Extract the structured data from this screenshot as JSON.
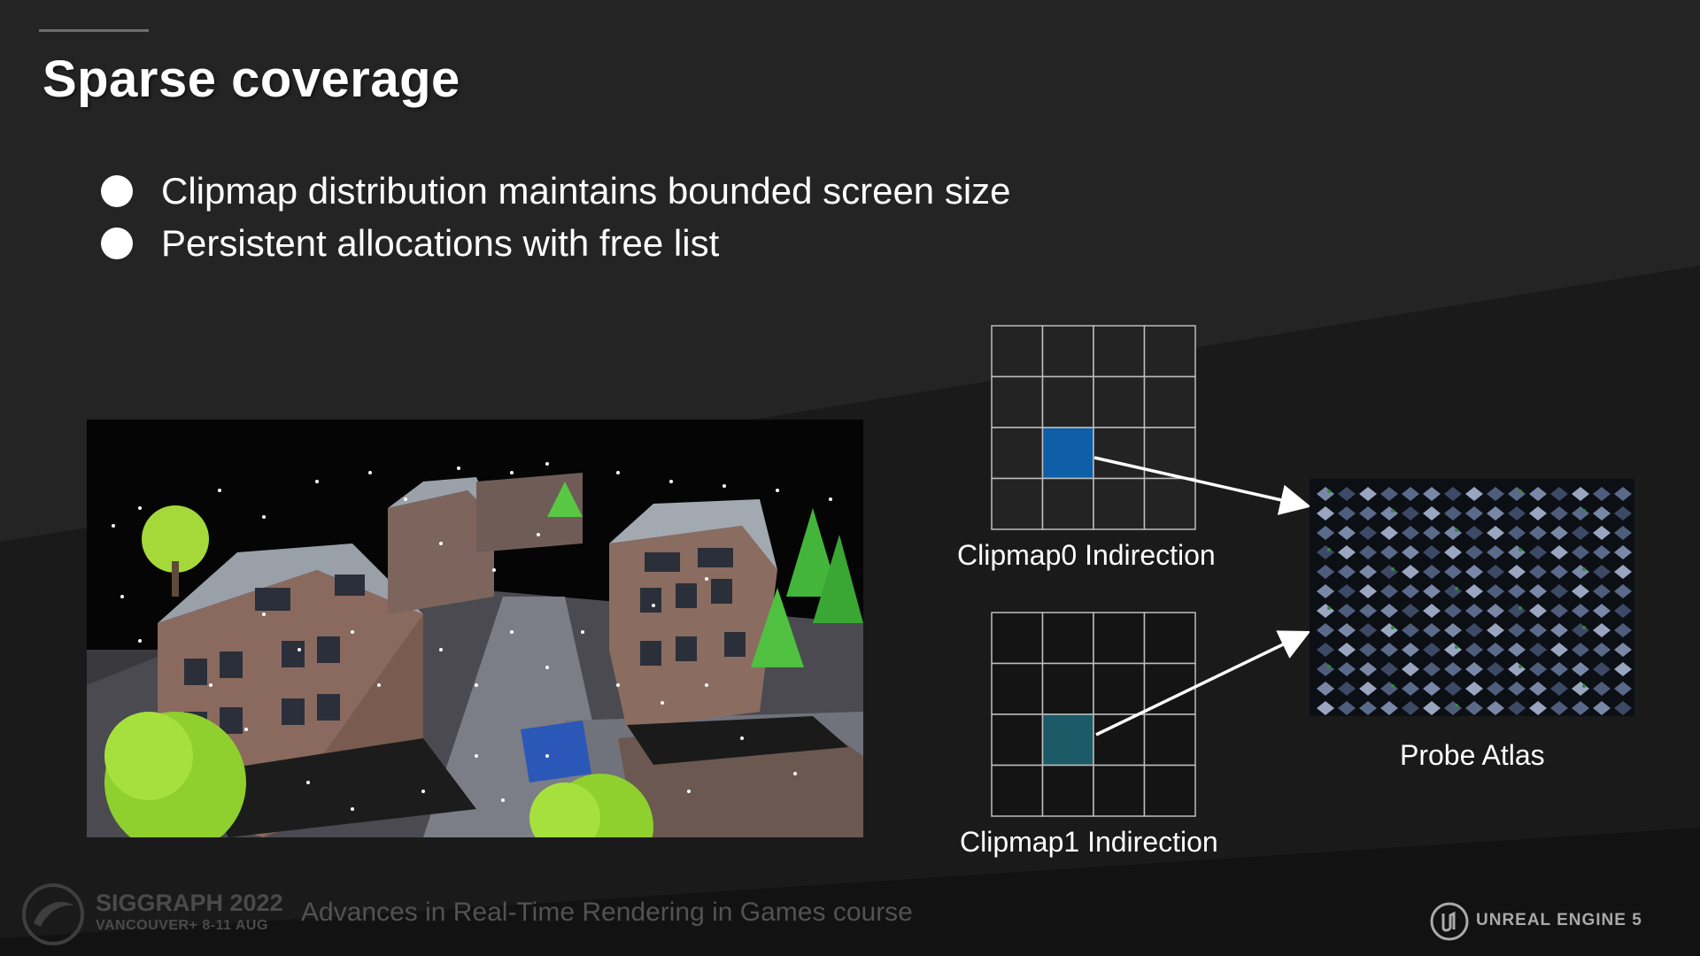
{
  "slide": {
    "title": "Sparse coverage",
    "bullets": [
      "Clipmap distribution maintains bounded screen size",
      "Persistent allocations with free list"
    ]
  },
  "diagram": {
    "clipmap0_label": "Clipmap0 Indirection",
    "clipmap1_label": "Clipmap1 Indirection",
    "atlas_label": "Probe Atlas",
    "grid": {
      "rows": 4,
      "cols": 4
    },
    "clipmap0_highlight": {
      "row": 2,
      "col": 1,
      "color": "#0e5ea8"
    },
    "clipmap1_highlight": {
      "row": 2,
      "col": 1,
      "color": "#1b5a66"
    }
  },
  "footer": {
    "conference": "SIGGRAPH 2022",
    "conference_sub": "VANCOUVER+  8-11 AUG",
    "course": "Advances in Real-Time Rendering in Games course",
    "engine": "UNREAL ENGINE 5"
  },
  "colors": {
    "background": "#242424",
    "diagonal_band": "#171717",
    "scene_grass": "#8fcf2e"
  }
}
